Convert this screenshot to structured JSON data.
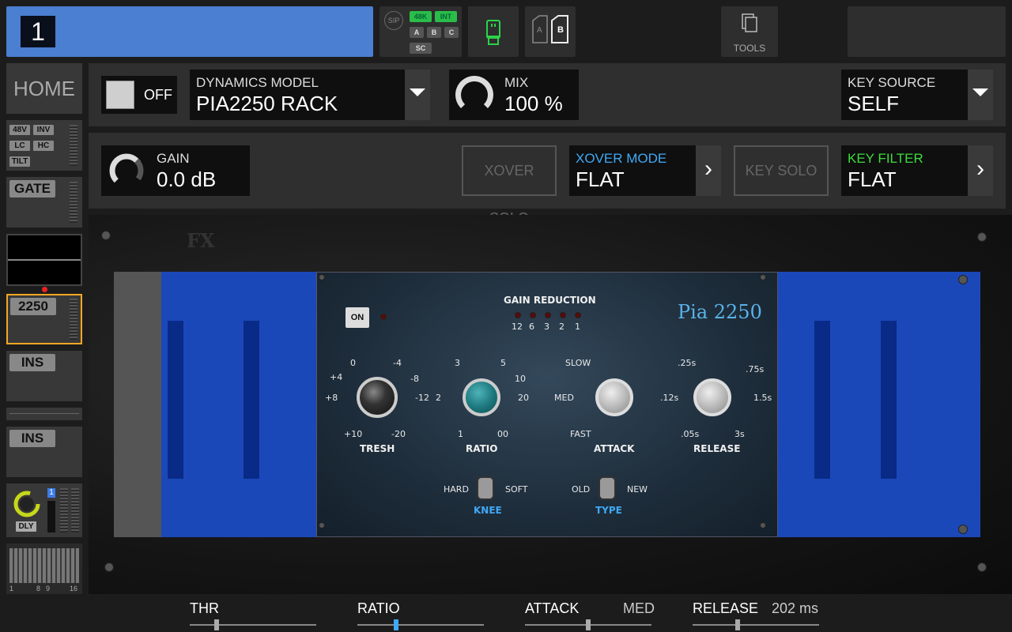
{
  "channel": {
    "number": "1"
  },
  "routing": {
    "sip": "SIP",
    "tags": [
      "48K",
      "INT",
      "A",
      "B",
      "C",
      "SC"
    ]
  },
  "card": {
    "a": "A",
    "b": "B"
  },
  "tools": {
    "label": "TOOLS"
  },
  "sidebar": {
    "home": "HOME",
    "input_tags": [
      "48V",
      "INV",
      "LC",
      "HC",
      "TILT"
    ],
    "gate": "GATE",
    "dyn": "2250",
    "ins1": "INS",
    "ins2": "INS",
    "dly": "DLY",
    "dly_badge": "1",
    "meter_labels": [
      "1",
      "8",
      "9",
      "16"
    ]
  },
  "header": {
    "toggle_label": "OFF",
    "dynamics_model_label": "DYNAMICS MODEL",
    "dynamics_model_value": "PIA2250 RACK",
    "mix_label": "MIX",
    "mix_value": "100 %",
    "key_source_label": "KEY SOURCE",
    "key_source_value": "SELF",
    "gain_label": "GAIN",
    "gain_value": "0.0 dB",
    "xover_solo": "XOVER SOLO",
    "xover_mode_label": "XOVER MODE",
    "xover_mode_value": "FLAT",
    "key_solo": "KEY SOLO",
    "key_filter_label": "KEY FILTER",
    "key_filter_value": "FLAT"
  },
  "plugin": {
    "brand": "FX",
    "on": "ON",
    "gain_reduction": "GAIN REDUCTION",
    "gr_scale": [
      "12",
      "6",
      "3",
      "2",
      "1"
    ],
    "name": "Pia 2250",
    "tresh": {
      "label": "TRESH",
      "ticks": [
        "0",
        "-4",
        "+4",
        "-8",
        "+8",
        "-12",
        "+10",
        "-20"
      ]
    },
    "ratio": {
      "label": "RATIO",
      "ticks": [
        "3",
        "5",
        "10",
        "2",
        "20",
        "1",
        "00"
      ]
    },
    "attack": {
      "label": "ATTACK",
      "ticks": [
        "SLOW",
        "MED",
        "FAST"
      ]
    },
    "release": {
      "label": "RELEASE",
      "ticks": [
        ".25s",
        ".75s",
        ".12s",
        "1.5s",
        ".05s",
        "3s"
      ]
    },
    "knee": {
      "label": "KNEE",
      "left": "HARD",
      "right": "SOFT"
    },
    "type": {
      "label": "TYPE",
      "left": "OLD",
      "right": "NEW"
    }
  },
  "bottom": {
    "thr": {
      "label": "THR",
      "value": "",
      "pos": 0.2
    },
    "ratio": {
      "label": "RATIO",
      "value": "",
      "pos": 0.3
    },
    "attack": {
      "label": "ATTACK",
      "value": "MED",
      "pos": 0.5
    },
    "release": {
      "label": "RELEASE",
      "value": "202 ms",
      "pos": 0.35
    }
  },
  "colors": {
    "accent_blue": "#4a7fd1",
    "green": "#2bbd4a",
    "selected": "#f5a623",
    "xover_blue": "#3fa9f5",
    "key_green": "#3ddc3d"
  }
}
